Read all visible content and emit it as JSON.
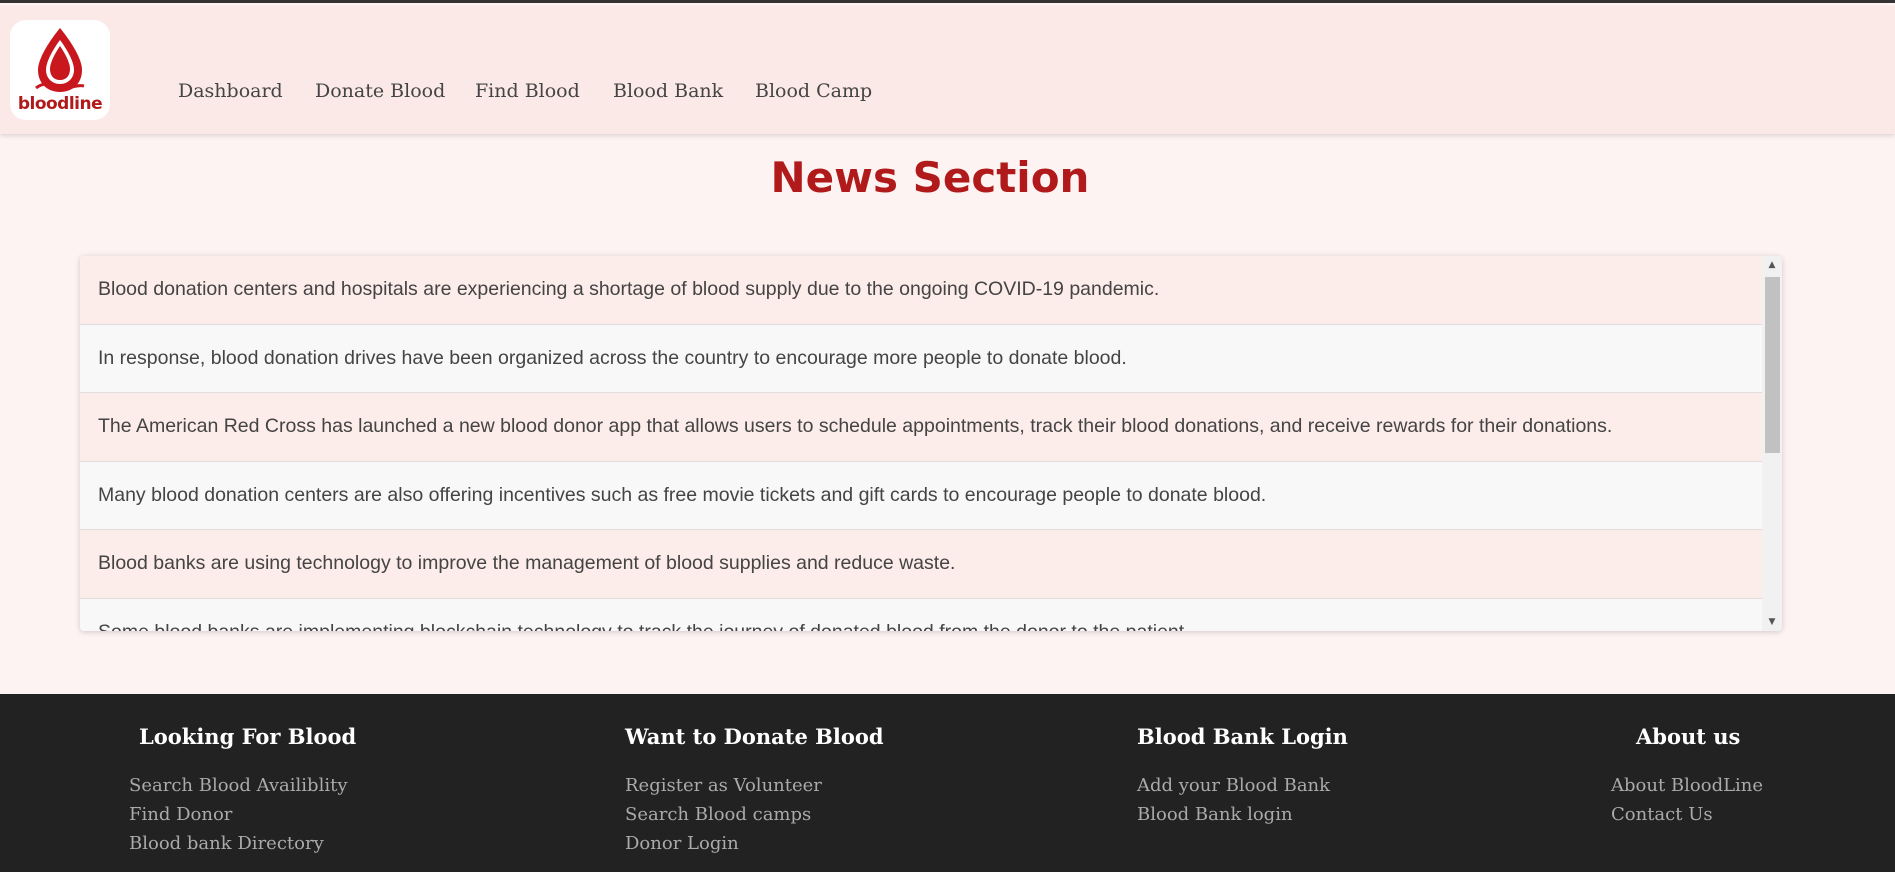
{
  "brand": {
    "logo_text_blood": "blood",
    "logo_text_line": "line",
    "logo_color": "#c8181e"
  },
  "nav": {
    "items": [
      {
        "label": "Dashboard"
      },
      {
        "label": "Donate Blood"
      },
      {
        "label": "Find Blood"
      },
      {
        "label": "Blood Bank"
      },
      {
        "label": "Blood Camp"
      }
    ]
  },
  "main": {
    "title": "News Section",
    "news": [
      "Blood donation centers and hospitals are experiencing a shortage of blood supply due to the ongoing COVID-19 pandemic.",
      "In response, blood donation drives have been organized across the country to encourage more people to donate blood.",
      "The American Red Cross has launched a new blood donor app that allows users to schedule appointments, track their blood donations, and receive rewards for their donations.",
      "Many blood donation centers are also offering incentives such as free movie tickets and gift cards to encourage people to donate blood.",
      "Blood banks are using technology to improve the management of blood supplies and reduce waste.",
      "Some blood banks are implementing blockchain technology to track the journey of donated blood from the donor to the patient."
    ]
  },
  "footer": {
    "columns": [
      {
        "heading": "Looking For Blood",
        "links": [
          "Search Blood Availiblity",
          "Find Donor",
          "Blood bank Directory"
        ]
      },
      {
        "heading": "Want to Donate Blood",
        "links": [
          "Register as Volunteer",
          "Search Blood camps",
          "Donor Login"
        ]
      },
      {
        "heading": "Blood Bank Login",
        "links": [
          "Add your Blood Bank",
          "Blood Bank login"
        ]
      },
      {
        "heading": "About us",
        "links": [
          "About BloodLine",
          "Contact Us"
        ]
      }
    ]
  },
  "colors": {
    "accent": "#b11a1a",
    "header_bg": "#fbe9e7",
    "footer_bg": "#222222"
  }
}
